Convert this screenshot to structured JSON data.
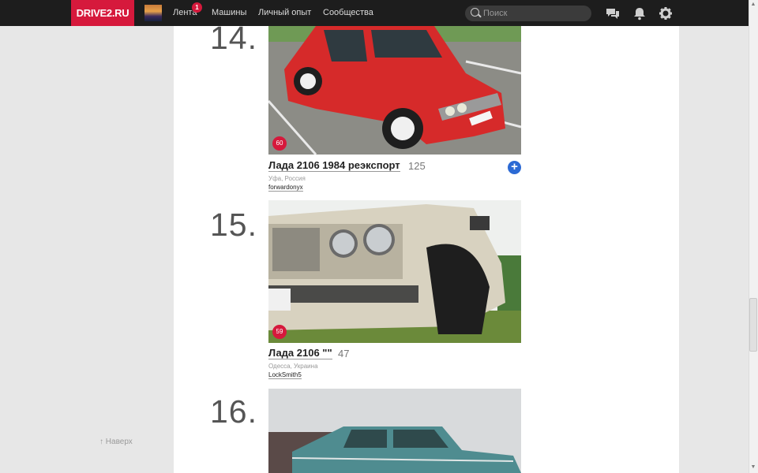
{
  "header": {
    "logo": "DRIVE2.RU",
    "nav": {
      "feed": "Лента",
      "feed_badge": "1",
      "cars": "Машины",
      "experience": "Личный опыт",
      "communities": "Сообщества"
    },
    "search": {
      "placeholder": "Поиск"
    },
    "icons": [
      "messages-icon",
      "bell-icon",
      "gear-icon"
    ]
  },
  "entries": [
    {
      "rank": "14.",
      "title": "Лада 2106 1984 реэкспорт",
      "count": "125",
      "location": "Уфа, Россия",
      "user": "forwardonyx",
      "likes": "60",
      "car_color": "#d62a2a"
    },
    {
      "rank": "15.",
      "title": "Лада 2106 \"\"",
      "count": "47",
      "location": "Одесса, Украина",
      "user": "LockSmith5",
      "likes": "59",
      "car_color": "#d8d2c0"
    },
    {
      "rank": "16.",
      "car_color": "#4f8c90"
    }
  ],
  "sidebar": {
    "back_to_top": "Наверх"
  },
  "colors": {
    "brand": "#d6193c",
    "topbar": "#1d1d1d",
    "accent": "#2c6ad4"
  }
}
